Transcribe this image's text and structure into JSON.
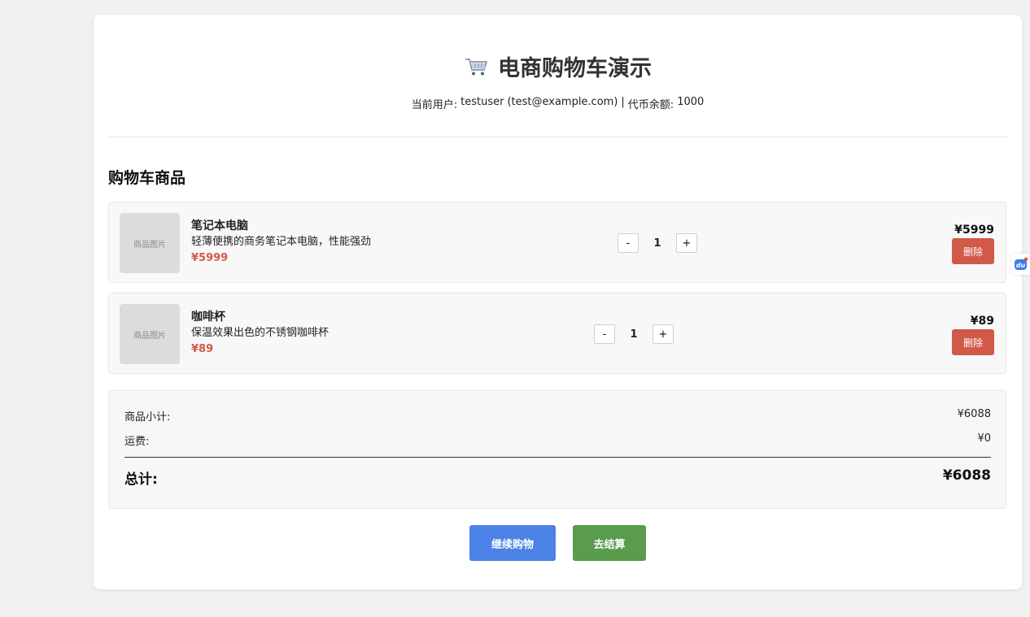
{
  "header": {
    "title": "电商购物车演示",
    "user_label": "当前用户:",
    "username": "testuser",
    "email": "(test@example.com)",
    "separator": "|",
    "balance_label": "代币余额:",
    "balance": "1000"
  },
  "section_title": "购物车商品",
  "items": [
    {
      "thumb_label": "商品图片",
      "name": "笔记本电脑",
      "description": "轻薄便携的商务笔记本电脑，性能强劲",
      "unit_price": "¥5999",
      "minus": "-",
      "quantity": "1",
      "plus": "+",
      "line_total": "¥5999",
      "delete_label": "删除"
    },
    {
      "thumb_label": "商品图片",
      "name": "咖啡杯",
      "description": "保温效果出色的不锈钢咖啡杯",
      "unit_price": "¥89",
      "minus": "-",
      "quantity": "1",
      "plus": "+",
      "line_total": "¥89",
      "delete_label": "删除"
    }
  ],
  "summary": {
    "subtotal_label": "商品小计:",
    "subtotal": "¥6088",
    "shipping_label": "运费:",
    "shipping": "¥0",
    "total_label": "总计:",
    "total": "¥6088"
  },
  "actions": {
    "continue_label": "继续购物",
    "checkout_label": "去结算"
  },
  "side_widget": {
    "text": "du"
  },
  "colors": {
    "accent_blue": "#4a82e6",
    "accent_green": "#5a9b4d",
    "delete_red": "#d1594a",
    "price_red": "#d25a47"
  },
  "icons": {
    "title_icon": "shopping-cart-icon",
    "side_icon": "baidu-paw-icon"
  }
}
